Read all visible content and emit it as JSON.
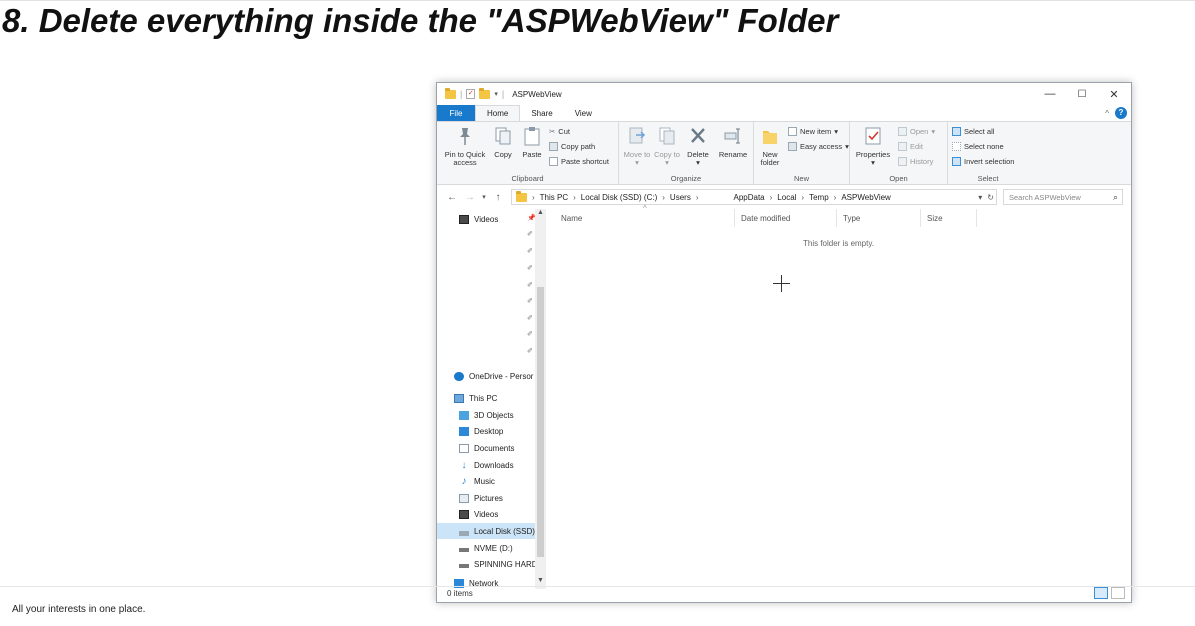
{
  "slide": {
    "headline": "8. Delete everything inside the \"ASPWebView\" Folder",
    "footer": "All your interests in one place."
  },
  "window": {
    "title": "ASPWebView",
    "controls": {
      "minimize": "—",
      "maximize": "☐",
      "close": "✕"
    }
  },
  "ribbon_tabs": {
    "file": "File",
    "home": "Home",
    "share": "Share",
    "view": "View"
  },
  "ribbon": {
    "clipboard": {
      "label": "Clipboard",
      "pin": "Pin to Quick access",
      "copy": "Copy",
      "paste": "Paste",
      "cut": "Cut",
      "copy_path": "Copy path",
      "paste_shortcut": "Paste shortcut"
    },
    "organize": {
      "label": "Organize",
      "move_to": "Move to",
      "copy_to": "Copy to",
      "delete": "Delete",
      "rename": "Rename"
    },
    "new": {
      "label": "New",
      "new_folder": "New folder",
      "new_item": "New item",
      "easy_access": "Easy access"
    },
    "open": {
      "label": "Open",
      "properties": "Properties",
      "open": "Open",
      "edit": "Edit",
      "history": "History"
    },
    "select": {
      "label": "Select",
      "select_all": "Select all",
      "select_none": "Select none",
      "invert_selection": "Invert selection"
    }
  },
  "address": {
    "crumbs": [
      "This PC",
      "Local Disk (SSD) (C:)",
      "Users",
      "AppData",
      "Local",
      "Temp",
      "ASPWebView"
    ],
    "search_placeholder": "Search ASPWebView"
  },
  "nav_pane": {
    "quick_top": "Videos",
    "onedrive": "OneDrive - Persor",
    "this_pc": "This PC",
    "items": [
      "3D Objects",
      "Desktop",
      "Documents",
      "Downloads",
      "Music",
      "Pictures",
      "Videos",
      "Local Disk (SSD)",
      "NVME (D:)",
      "SPINNING HARD"
    ],
    "network": "Network"
  },
  "columns": {
    "name": "Name",
    "date_modified": "Date modified",
    "type": "Type",
    "size": "Size"
  },
  "content": {
    "empty_message": "This folder is empty."
  },
  "status": {
    "items": "0 items"
  },
  "colors": {
    "accent": "#1979ca",
    "folder": "#f4c542",
    "selection": "#cce4f7",
    "ribbon_bg": "#f5f6f7"
  }
}
